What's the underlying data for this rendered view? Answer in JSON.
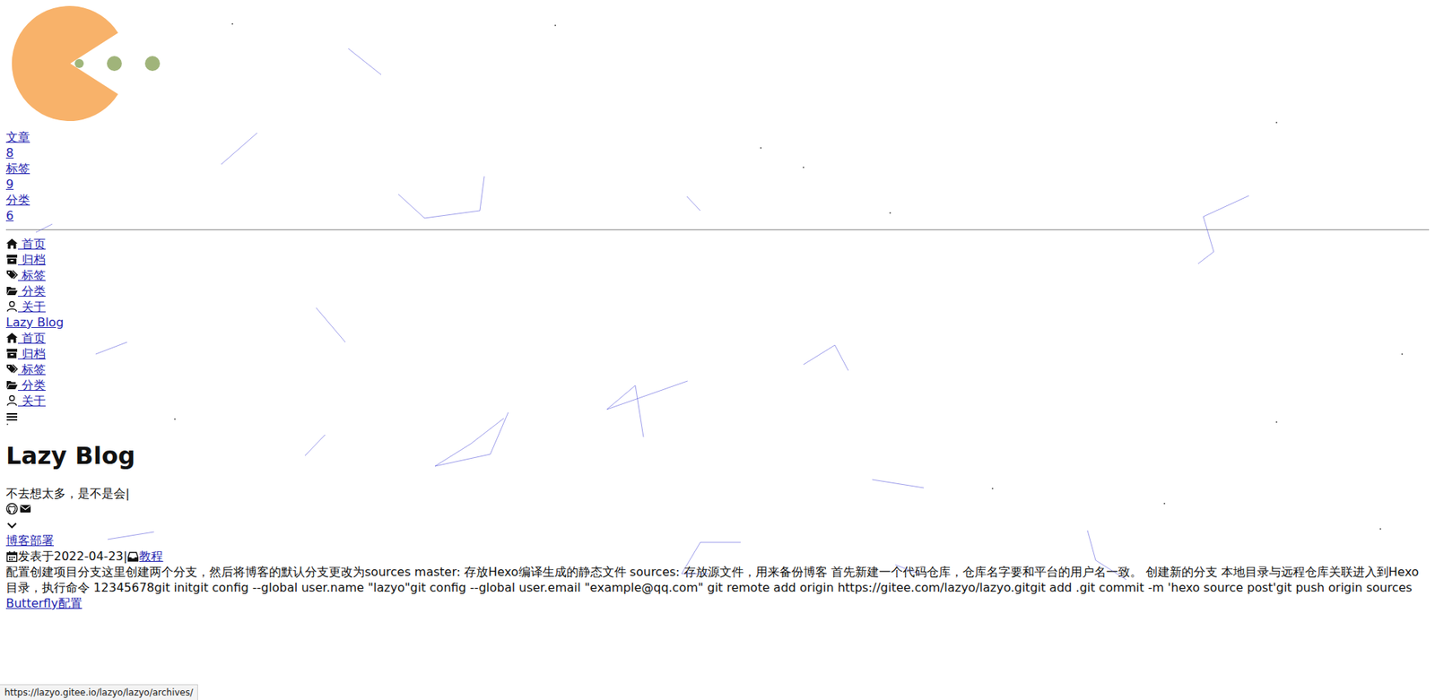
{
  "site_stats": [
    {
      "label": "文章",
      "count": "8"
    },
    {
      "label": "标签",
      "count": "9"
    },
    {
      "label": "分类",
      "count": "6"
    }
  ],
  "menu": [
    {
      "label": " 首页"
    },
    {
      "label": " 归档"
    },
    {
      "label": " 标签"
    },
    {
      "label": " 分类"
    },
    {
      "label": " 关于"
    }
  ],
  "nav": {
    "site_title": "Lazy Blog",
    "items": [
      {
        "label": " 首页"
      },
      {
        "label": " 归档"
      },
      {
        "label": " 标签"
      },
      {
        "label": " 分类"
      },
      {
        "label": " 关于"
      }
    ]
  },
  "hero": {
    "title": "Lazy Blog",
    "subtitle": "不去想太多，是不是会",
    "cursor": "|"
  },
  "posts": [
    {
      "title": "博客部署",
      "date_label": "发表于",
      "date": "2022-04-23",
      "separator": "|",
      "category": "教程",
      "excerpt": "配置创建项目分支这里创建两个分支，然后将博客的默认分支更改为sources master: 存放Hexo编译生成的静态文件 sources: 存放源文件，用来备份博客 首先新建一个代码仓库，仓库名字要和平台的用户名一致。 创建新的分支 本地目录与远程仓库关联进入到Hexo目录，执行命令 12345678git initgit config --global user.name \"lazyo\"git config --global user.email \"example@qq.com\" git remote add origin https://gitee.com/lazyo/lazyo.gitgit add .git commit -m 'hexo source post'git push origin sources"
    },
    {
      "title": "Butterfly配置"
    }
  ],
  "status_bar": {
    "url": "https://lazyo.gitee.io/lazyo/lazyo/archives/"
  }
}
